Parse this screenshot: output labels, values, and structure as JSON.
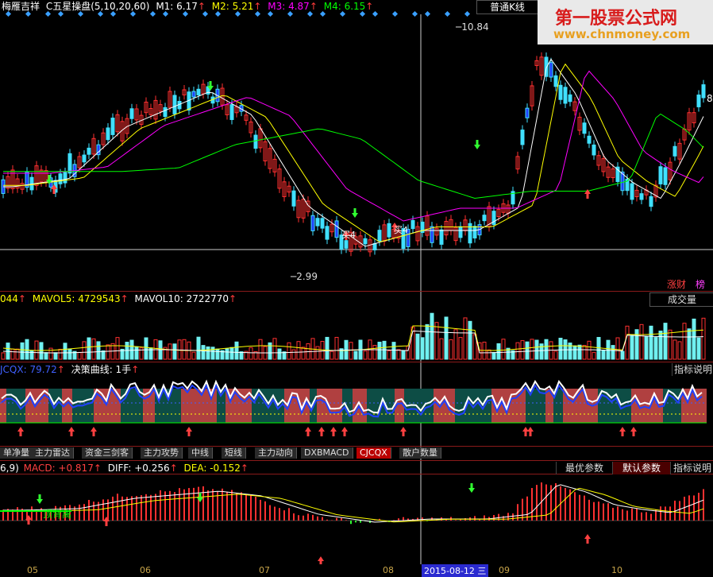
{
  "header": {
    "indicator_name": "梅雁吉祥",
    "formula": "C五星操盘(5,10,20,60)",
    "ma": [
      {
        "label": "M1: 6.17",
        "color": "#ffffff"
      },
      {
        "label": "M2: 5.21",
        "color": "#ffff00"
      },
      {
        "label": "M3: 4.87",
        "color": "#ff00ff"
      },
      {
        "label": "M4: 6.15",
        "color": "#00ff00"
      }
    ],
    "kline_button": "普通K线"
  },
  "watermark": {
    "title": "第一股票公式网",
    "url": "www.chnmoney.com"
  },
  "main_chart": {
    "high_label": "10.84",
    "low_label": "2.99",
    "right_label": "8",
    "buy_label_1": "买4",
    "buy_label_2": "买4",
    "badge_1": "涨财",
    "badge_2": "榜"
  },
  "volume_panel": {
    "lead": "044",
    "mavol5": "MAVOL5: 4729543",
    "mavol10": "MAVOL10: 2722770",
    "button": "成交量"
  },
  "cjcqx_panel": {
    "lead": "JCQX: 79.72",
    "line_label": "决策曲线: 1手",
    "button": "指标说明"
  },
  "tabs": [
    {
      "label": "单净量",
      "active": false
    },
    {
      "label": "主力雷达",
      "active": false
    },
    {
      "label": "资金三剑客",
      "active": false
    },
    {
      "label": "主力攻势",
      "active": false
    },
    {
      "label": "中线",
      "active": false
    },
    {
      "label": "短线",
      "active": false
    },
    {
      "label": "主力动向",
      "active": false
    },
    {
      "label": "DXBMACD",
      "active": false
    },
    {
      "label": "CJCQX",
      "active": true
    },
    {
      "label": "散户数量",
      "active": false
    }
  ],
  "macd_panel": {
    "lead": "6,9)",
    "macd": "MACD: +0.817",
    "diff": "DIFF: +0.256",
    "dea": "DEA: -0.152",
    "divergence_label": "顶背离",
    "buttons": [
      {
        "label": "最优参数",
        "selected": false
      },
      {
        "label": "默认参数",
        "selected": true
      },
      {
        "label": "指标说明",
        "selected": false
      }
    ]
  },
  "dates": {
    "d05": "05",
    "d06": "06",
    "d07": "07",
    "d08": "08",
    "cursor": "2015-08-12 三",
    "d09": "09",
    "d10": "10"
  }
}
